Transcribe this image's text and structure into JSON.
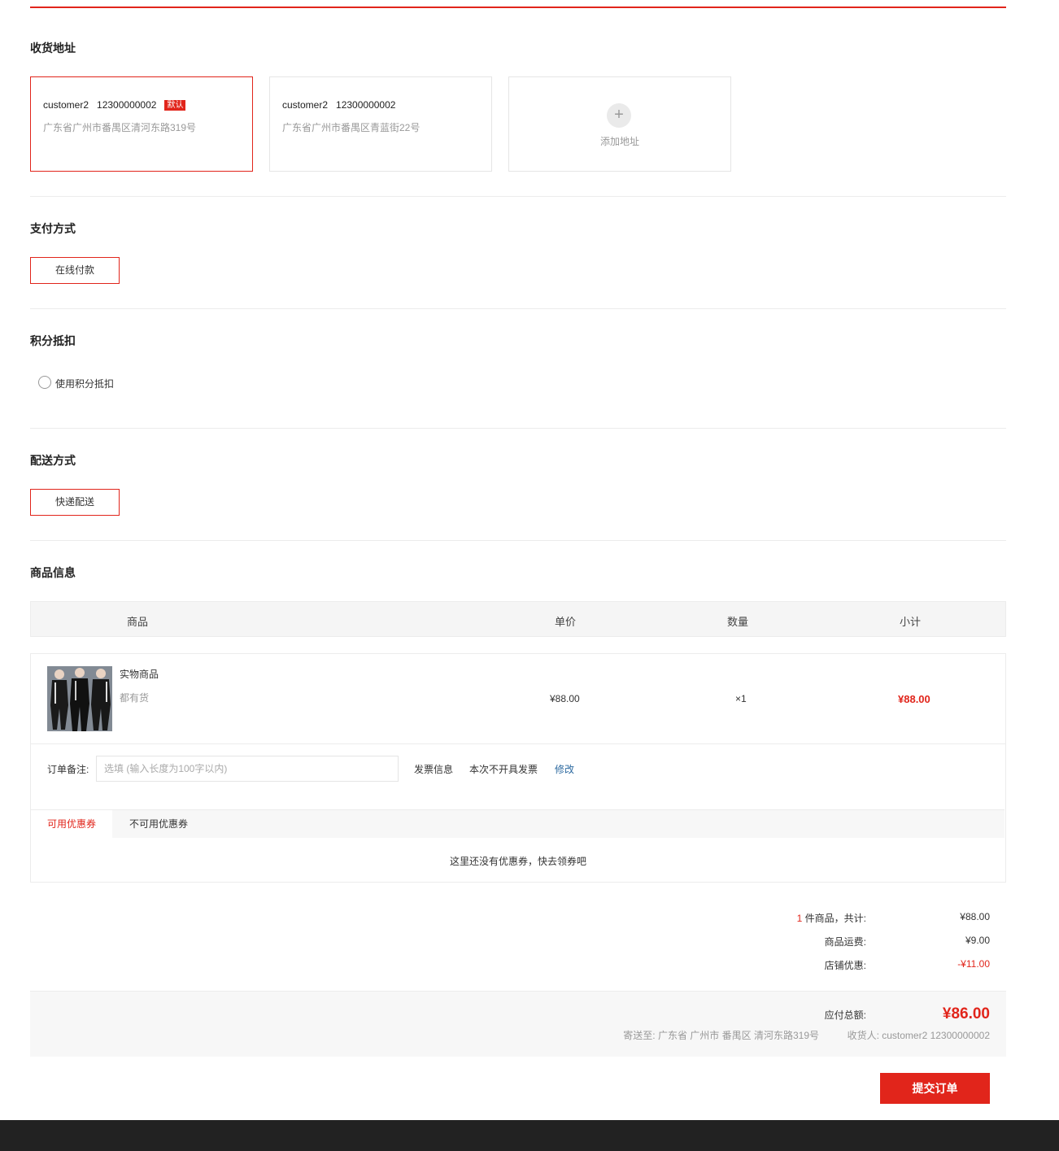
{
  "address_section": {
    "title": "收货地址",
    "cards": [
      {
        "name": "customer2",
        "phone": "12300000002",
        "badge": "默认",
        "detail": "广东省广州市番禺区清河东路319号",
        "selected": true
      },
      {
        "name": "customer2",
        "phone": "12300000002",
        "detail": "广东省广州市番禺区青蓝街22号",
        "selected": false
      }
    ],
    "add_label": "添加地址",
    "add_icon": "plus-icon"
  },
  "payment_section": {
    "title": "支付方式",
    "option": "在线付款"
  },
  "points_section": {
    "title": "积分抵扣",
    "checkbox_label": "使用积分抵扣",
    "checked": false
  },
  "delivery_section": {
    "title": "配送方式",
    "option": "快递配送"
  },
  "goods_section": {
    "title": "商品信息",
    "columns": [
      "商品",
      "单价",
      "数量",
      "小计"
    ],
    "items": [
      {
        "name": "实物商品",
        "stock": "都有货",
        "price": "¥88.00",
        "quantity": "×1",
        "subtotal": "¥88.00"
      }
    ],
    "note_label": "订单备注:",
    "note_placeholder": "选填 (输入长度为100字以内)",
    "invoice_label": "发票信息",
    "invoice_value": "本次不开具发票",
    "invoice_edit": "修改",
    "coupon_tabs": [
      "可用优惠券",
      "不可用优惠券"
    ],
    "coupon_empty": "这里还没有优惠券，快去领券吧"
  },
  "summary": {
    "count": "1",
    "count_label": "件商品，共计:",
    "goods_total": "¥88.00",
    "shipping_label": "商品运费:",
    "shipping": "¥9.00",
    "discount_label": "店铺优惠:",
    "discount": "-¥11.00",
    "payable_label": "应付总额:",
    "payable": "¥86.00",
    "ship_to": "寄送至: 广东省 广州市 番禺区 清河东路319号",
    "receiver": "收货人: customer2 12300000002"
  },
  "submit_label": "提交订单",
  "colors": {
    "accent": "#e1251b",
    "link": "#2d6aa0"
  }
}
